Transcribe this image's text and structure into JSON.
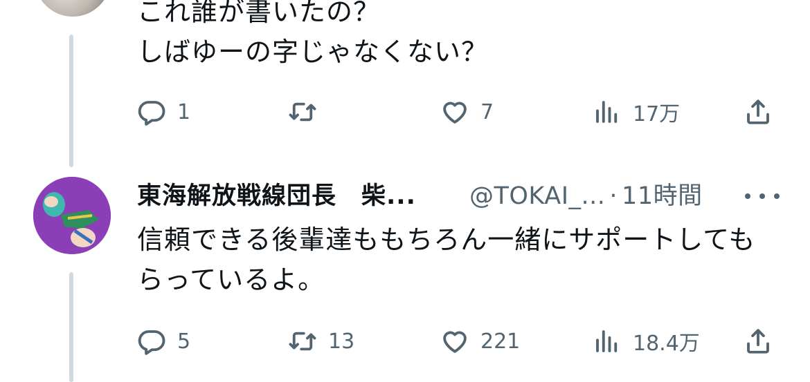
{
  "tweets": [
    {
      "text_lines": [
        "これ誰が書いたの？",
        "しばゆーの字じゃなくない？"
      ],
      "actions": {
        "replies": "1",
        "retweets": "",
        "likes": "7",
        "views": "17万"
      }
    },
    {
      "display_name": "東海解放戦線団長　柴...",
      "handle": "@TOKAI_...",
      "separator": "·",
      "time": "11時間",
      "text_lines": [
        "信頼できる後輩達ももちろん一緒にサポートしても",
        "らっているよ。"
      ],
      "actions": {
        "replies": "5",
        "retweets": "13",
        "likes": "221",
        "views": "18.4万"
      }
    }
  ],
  "icons": {
    "reply": "reply-icon",
    "retweet": "retweet-icon",
    "like": "heart-icon",
    "views": "views-icon",
    "share": "share-icon",
    "more": "more-icon"
  },
  "colors": {
    "text": "#0f1419",
    "secondary": "#536471",
    "thread_line": "#cfd9de"
  }
}
